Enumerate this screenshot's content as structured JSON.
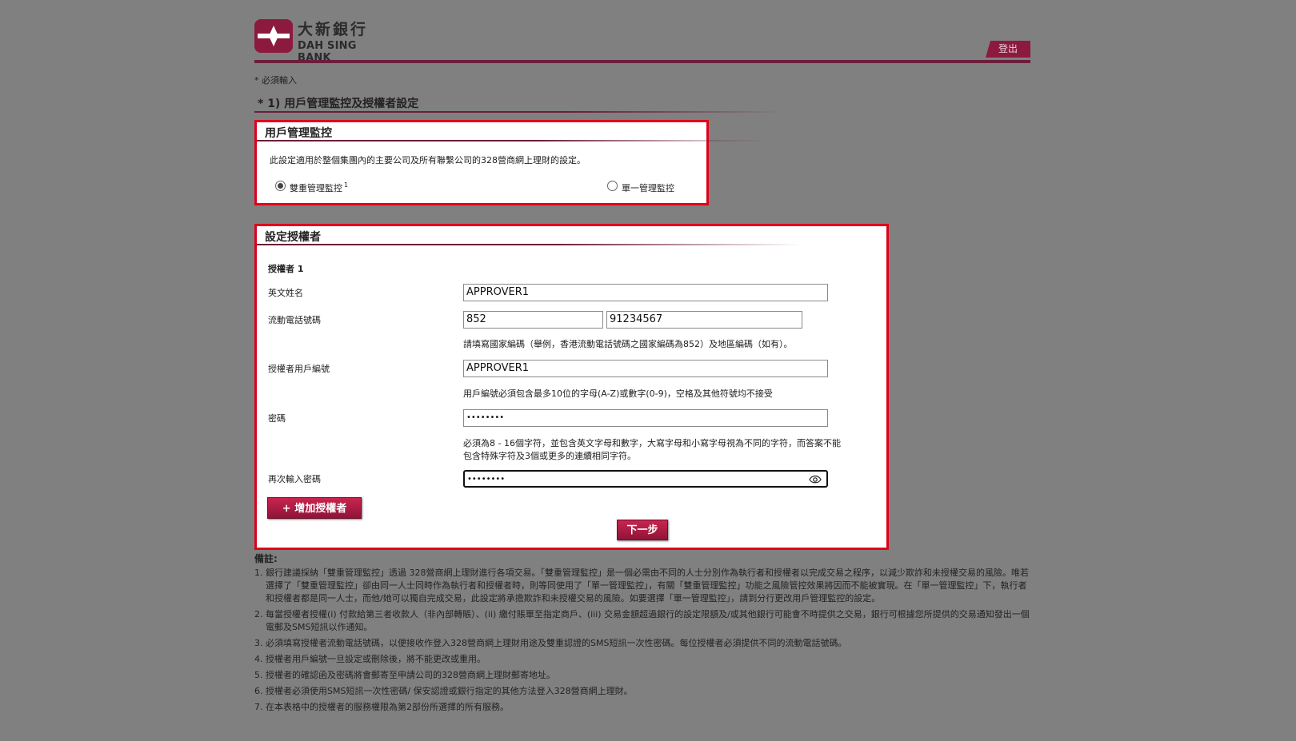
{
  "header": {
    "logo_zh": "大新銀行",
    "logo_en": "DAH SING BANK",
    "logout_label": "登出"
  },
  "required_note": "* 必須輸入",
  "section_title": "* 1) 用戶管理監控及授權者設定",
  "control_panel": {
    "title": "用戶管理監控",
    "description": "此設定適用於整個集團內的主要公司及所有聯繫公司的328營商網上理財的設定。",
    "option_dual": "雙重管理監控",
    "option_dual_sup": "1",
    "option_single": "單一管理監控",
    "selected": "dual"
  },
  "approver_panel": {
    "title": "設定授權者",
    "approver_heading": "授權者 1",
    "english_name_label": "英文姓名",
    "english_name_value": "APPROVER1",
    "mobile_label": "流動電話號碼",
    "mobile_country_code": "852",
    "mobile_number": "91234567",
    "mobile_hint": "請填寫國家編碼（舉例，香港流動電話號碼之國家編碼為852）及地區編碼（如有）。",
    "user_id_label": "授權者用戶編號",
    "user_id_value": "APPROVER1",
    "user_id_hint": "用戶編號必須包含最多10位的字母(A-Z)或數字(0-9)，空格及其他符號均不接受",
    "password_label": "密碼",
    "password_value": "••••••••",
    "password_hint_1": "必須為8 - 16個字符，並包含英文字母和數字，大寫字母和小寫字母視為不同的字符，而答案不能",
    "password_hint_2": "包含特殊字符及3個或更多的連續相同字符。",
    "confirm_password_label": "再次輸入密碼",
    "confirm_password_value": "••••••••",
    "add_approver_label": "+ 增加授權者",
    "next_label": "下一步"
  },
  "remarks": {
    "title": "備註:",
    "items": [
      {
        "num": "1.",
        "text": "銀行建議採納「雙重管理監控」透過 328營商網上理財進行各項交易。「雙重管理監控」是一個必需由不同的人士分別作為執行者和授權者以完成交易之程序，以減少欺詐和未授權交易的風險。唯若選擇了「雙重管理監控」卻由同一人士同時作為執行者和授權者時，則等同使用了「單一管理監控」，有關「雙重管理監控」功能之風險管控效果將因而不能被實現。在「單一管理監控」下，執行者和授權者都是同一人士，而他/她可以獨自完成交易，此設定將承擔欺詐和未授權交易的風險。如要選擇「單一管理監控」，請到分行更改用戶管理監控的設定。"
      },
      {
        "num": "2.",
        "text": "每當授權者授權(i) 付款給第三者收款人（非內部轉賬）、(ii) 繳付賬單至指定商戶、(iii) 交易金額超過銀行的設定限額及/或其他銀行可能會不時提供之交易，銀行可根據您所提供的交易通知發出一個電郵及SMS短訊以作通知。"
      },
      {
        "num": "3.",
        "text": "必須填寫授權者流動電話號碼，以便接收作登入328營商網上理財用途及雙重認證的SMS短訊一次性密碼。每位授權者必須提供不同的流動電話號碼。"
      },
      {
        "num": "4.",
        "text": "授權者用戶編號一旦設定或刪除後，將不能更改或重用。"
      },
      {
        "num": "5.",
        "text": "授權者的確認函及密碼將會郵寄至申請公司的328營商網上理財郵寄地址。"
      },
      {
        "num": "6.",
        "text": "授權者必須使用SMS短訊一次性密碼/ 保安認證或銀行指定的其他方法登入328營商網上理財。"
      },
      {
        "num": "7.",
        "text": "在本表格中的授權者的服務權限為第2部份所選擇的所有服務。"
      }
    ]
  },
  "colors": {
    "brand": "#8b1a3e",
    "highlight_border": "#e0001b",
    "background": "#808080"
  },
  "icons": {
    "logo": "dah-sing-logo-icon",
    "password_reveal": "eye-icon"
  }
}
